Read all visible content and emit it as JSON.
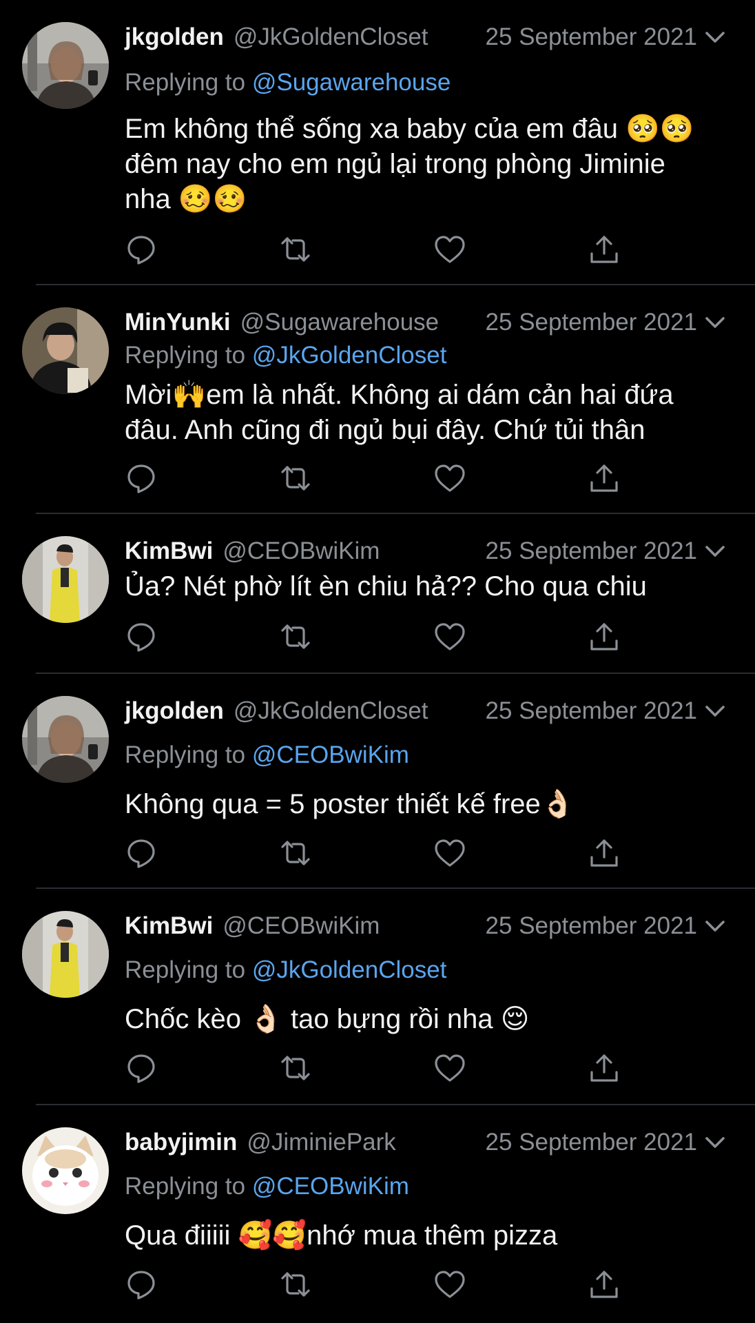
{
  "tweets": [
    {
      "name": "jkgolden",
      "handle": "@JkGoldenCloset",
      "date": "25 September 2021",
      "replying_prefix": "Replying to ",
      "replying_to": "@Sugawarehouse",
      "text": "Em không thể sống xa baby của em đâu 🥺🥺 đêm nay cho em ngủ lại trong phòng Jiminie nha 🥴🥴"
    },
    {
      "name": "MinYunki",
      "handle": "@Sugawarehouse",
      "date": "25 September 2021",
      "replying_prefix": "Replying to ",
      "replying_to": "@JkGoldenCloset",
      "text": "Mời🙌em là nhất. Không ai dám cản hai đứa đâu. Anh cũng đi ngủ bụi đây. Chứ tủi thân"
    },
    {
      "name": "KimBwi",
      "handle": "@CEOBwiKim",
      "date": "25 September 2021",
      "replying_prefix": "",
      "replying_to": "",
      "text": "Ủa? Nét phờ lít èn chiu hả?? Cho qua chiu"
    },
    {
      "name": "jkgolden",
      "handle": "@JkGoldenCloset",
      "date": "25 September 2021",
      "replying_prefix": "Replying to ",
      "replying_to": "@CEOBwiKim",
      "text": "Không qua = 5 poster thiết kế free👌🏻"
    },
    {
      "name": "KimBwi",
      "handle": "@CEOBwiKim",
      "date": "25 September 2021",
      "replying_prefix": "Replying to ",
      "replying_to": "@JkGoldenCloset",
      "text": "Chốc kèo 👌🏻 tao bựng rồi nha 😌"
    },
    {
      "name": "babyjimin",
      "handle": "@JiminiePark",
      "date": "25 September 2021",
      "replying_prefix": "Replying to ",
      "replying_to": "@CEOBwiKim",
      "text": "Qua điiiii 🥰🥰nhớ mua thêm pizza"
    }
  ],
  "icons": {
    "reply": "reply-icon",
    "retweet": "retweet-icon",
    "like": "like-icon",
    "share": "share-icon",
    "menu": "chevron-down-icon"
  },
  "colors": {
    "background": "#000000",
    "name": "#f2f2f2",
    "secondary": "#8b9096",
    "mention": "#5aa5ee",
    "divider": "#2a2d31"
  }
}
